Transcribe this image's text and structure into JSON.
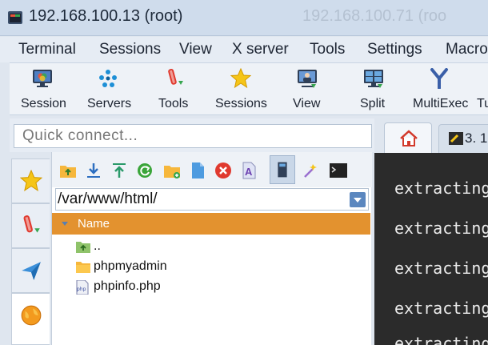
{
  "window": {
    "title": "192.168.100.13 (root)",
    "ghost_title": "192.168.100.71 (roo"
  },
  "menu": [
    "Terminal",
    "Sessions",
    "View",
    "X server",
    "Tools",
    "Settings",
    "Macro"
  ],
  "toolbar": [
    {
      "label": "Session",
      "icon": "session-icon"
    },
    {
      "label": "Servers",
      "icon": "servers-icon"
    },
    {
      "label": "Tools",
      "icon": "tools-icon"
    },
    {
      "label": "Sessions",
      "icon": "sessions-star-icon"
    },
    {
      "label": "View",
      "icon": "view-icon"
    },
    {
      "label": "Split",
      "icon": "split-icon"
    },
    {
      "label": "MultiExec",
      "icon": "multiexec-icon"
    },
    {
      "label": "Tu",
      "icon": "tunneling-icon"
    }
  ],
  "quick_connect": {
    "placeholder": "Quick connect..."
  },
  "side_tabs": [
    "sessions-star-icon",
    "tools-icon",
    "macros-icon",
    "sftp-globe-icon"
  ],
  "sftp": {
    "path": "/var/www/html/",
    "column_header": "Name",
    "files": [
      {
        "name": "..",
        "icon": "parent-folder-icon"
      },
      {
        "name": "phpmyadmin",
        "icon": "folder-icon"
      },
      {
        "name": "phpinfo.php",
        "icon": "php-file-icon"
      }
    ],
    "toolbar_icons": [
      "up-folder-icon",
      "download-icon",
      "upload-icon",
      "refresh-icon",
      "new-folder-icon",
      "new-file-icon",
      "delete-icon",
      "rename-icon",
      "open-terminal-folder-icon",
      "follow-terminal-icon",
      "terminal-icon"
    ]
  },
  "tabs": {
    "home_icon": "home-icon",
    "session_tab_label": "3. 1"
  },
  "terminal": {
    "lines": [
      "extracting",
      "extracting",
      "extracting",
      "extracting",
      "extracting"
    ]
  },
  "colors": {
    "accent_orange": "#e3922f",
    "titlebar": "#cfdcec",
    "terminal_bg": "#2b2b2b"
  }
}
